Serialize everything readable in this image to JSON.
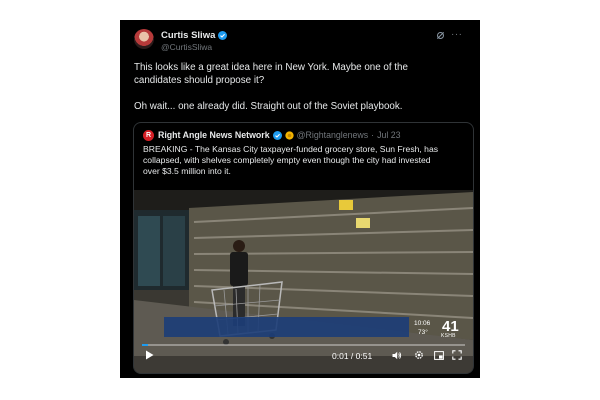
{
  "author": {
    "name": "Curtis Sliwa",
    "handle": "@CurtisSliwa",
    "avatar_icon": "avatar-photo",
    "verified_icon": "verified-badge-icon",
    "verified_color": "#1d9bf0"
  },
  "header_icons": [
    "grok-icon",
    "more-icon"
  ],
  "tweet": {
    "line1": "This looks like a great idea here in New York. Maybe one of the",
    "line2": "candidates should propose it?",
    "line3": "Oh wait... one already did. Straight out of the Soviet playbook."
  },
  "quoted": {
    "logo_letter": "R",
    "logo_color": "#d51f26",
    "name": "Right Angle News Network",
    "handle": "@Rightanglenews",
    "separator": "·",
    "date": "Jul 23",
    "text_line1": "BREAKING - The Kansas City taxpayer-funded grocery store, Sun Fresh, has",
    "text_line2": "collapsed, with shelves completely empty even though the city had invested",
    "text_line3": "over $3.5 million into it."
  },
  "video": {
    "elapsed": "0:01",
    "duration": "0:51",
    "time_display": "0:01 / 0:51",
    "progress_fraction": 0.02,
    "accent_color": "#1d9bf0",
    "overlay_time": "10:06",
    "overlay_temp": "73°",
    "overlay_channel": "41",
    "overlay_callsign": "KSHB",
    "controls": [
      "play-icon",
      "volume-icon",
      "settings-gear-icon",
      "picture-in-picture-icon",
      "fullscreen-icon"
    ]
  }
}
